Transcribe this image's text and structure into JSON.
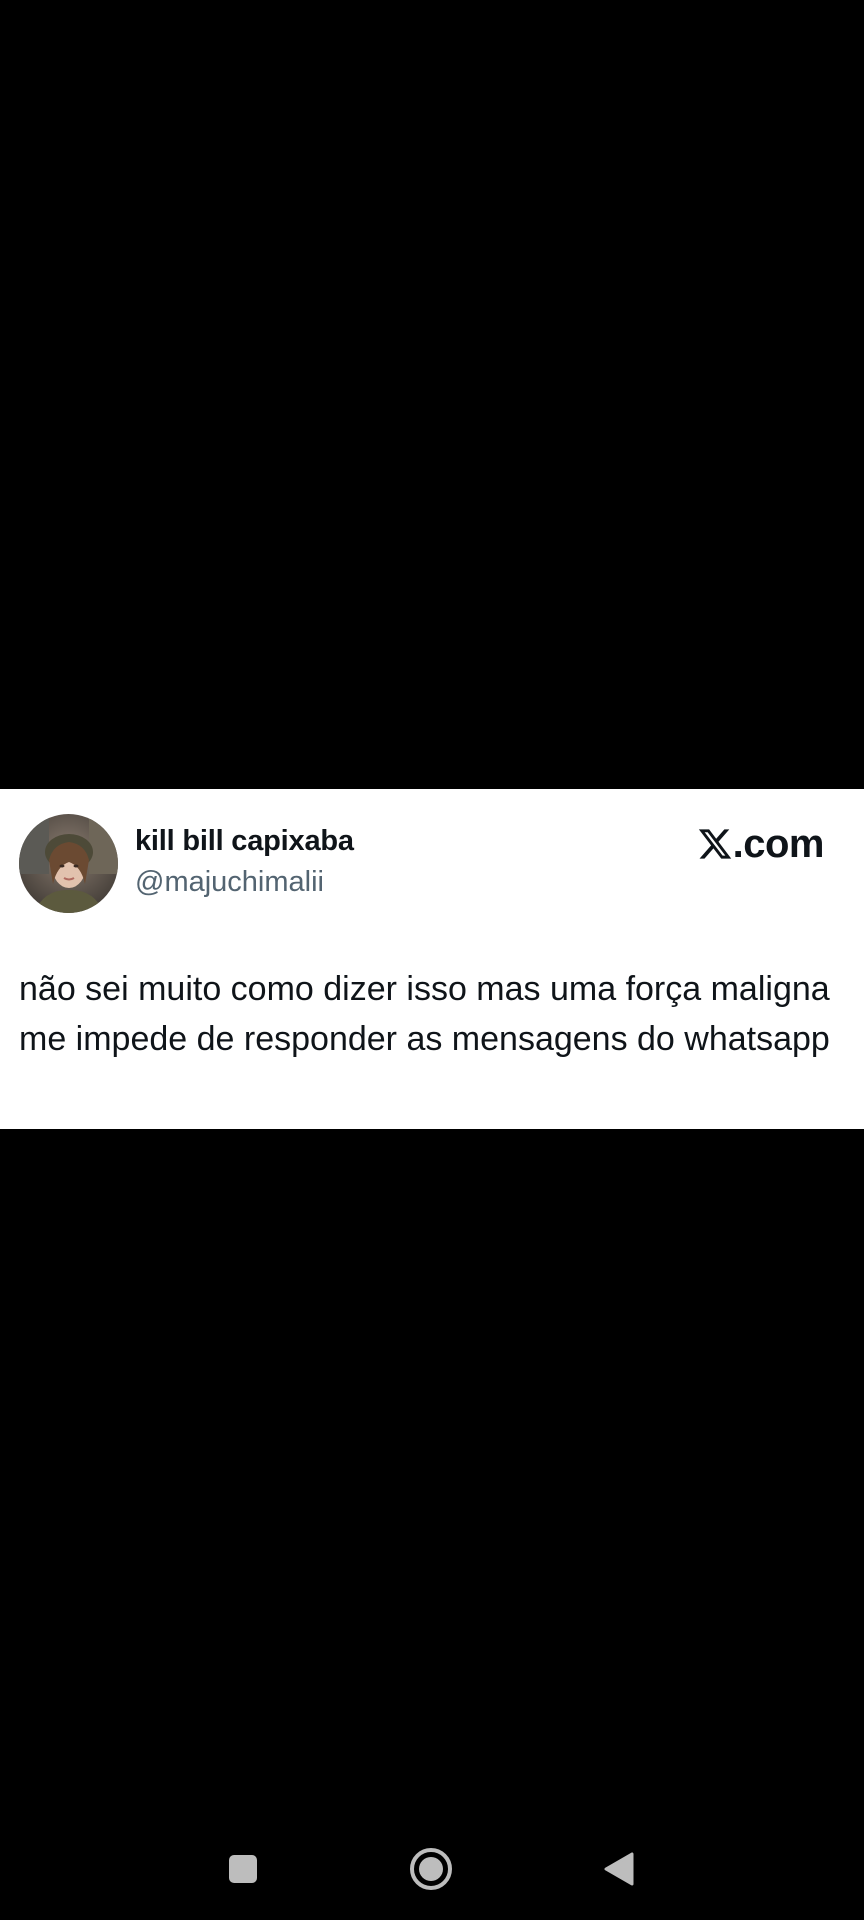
{
  "tweet": {
    "display_name": "kill bill capixaba",
    "handle": "@majuchimalii",
    "brand": ".com",
    "text": "não sei muito como dizer isso mas uma força maligna me impede de responder as mensagens do whatsapp"
  },
  "icons": {
    "brand_logo": "x-logo-icon",
    "avatar": "avatar-image",
    "recent_apps": "square-icon",
    "home": "circle-home-icon",
    "back": "triangle-back-icon"
  },
  "colors": {
    "background": "#000000",
    "card": "#ffffff",
    "primary_text": "#0f1419",
    "secondary_text": "#536471",
    "nav_icons": "#bdbdbd"
  }
}
